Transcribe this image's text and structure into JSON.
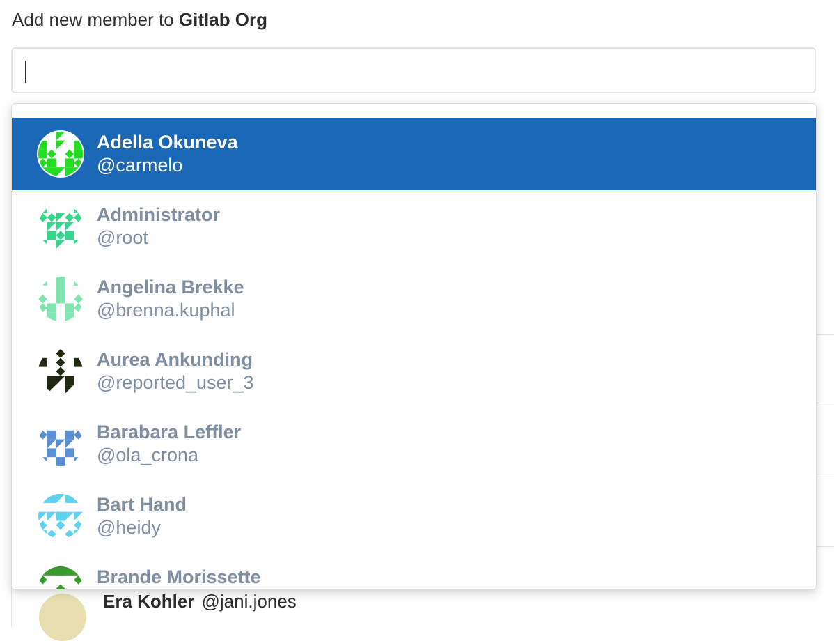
{
  "header": {
    "title_prefix": "Add new member to",
    "group_name": "Gitlab Org"
  },
  "search": {
    "value": "",
    "placeholder": ""
  },
  "dropdown": {
    "active_index": 0,
    "items": [
      {
        "name": "Adella Okuneva",
        "username": "@carmelo",
        "avatar_color": "#22dd22",
        "avatar_icon": "identicon"
      },
      {
        "name": "Administrator",
        "username": "@root",
        "avatar_color": "#33d68a",
        "avatar_icon": "identicon"
      },
      {
        "name": "Angelina Brekke",
        "username": "@brenna.kuphal",
        "avatar_color": "#7fe6b0",
        "avatar_icon": "identicon"
      },
      {
        "name": "Aurea Ankunding",
        "username": "@reported_user_3",
        "avatar_color": "#1f2a10",
        "avatar_icon": "identicon"
      },
      {
        "name": "Barabara Leffler",
        "username": "@ola_crona",
        "avatar_color": "#5a8fd6",
        "avatar_icon": "identicon"
      },
      {
        "name": "Bart Hand",
        "username": "@heidy",
        "avatar_color": "#5fd2f2",
        "avatar_icon": "identicon"
      },
      {
        "name": "Brande Morissette",
        "username": "",
        "avatar_color": "#3b9a2e",
        "avatar_icon": "identicon"
      }
    ]
  },
  "background_member": {
    "name": "Era Kohler",
    "username": "@jani.jones",
    "avatar_color": "#e8dfb0"
  }
}
